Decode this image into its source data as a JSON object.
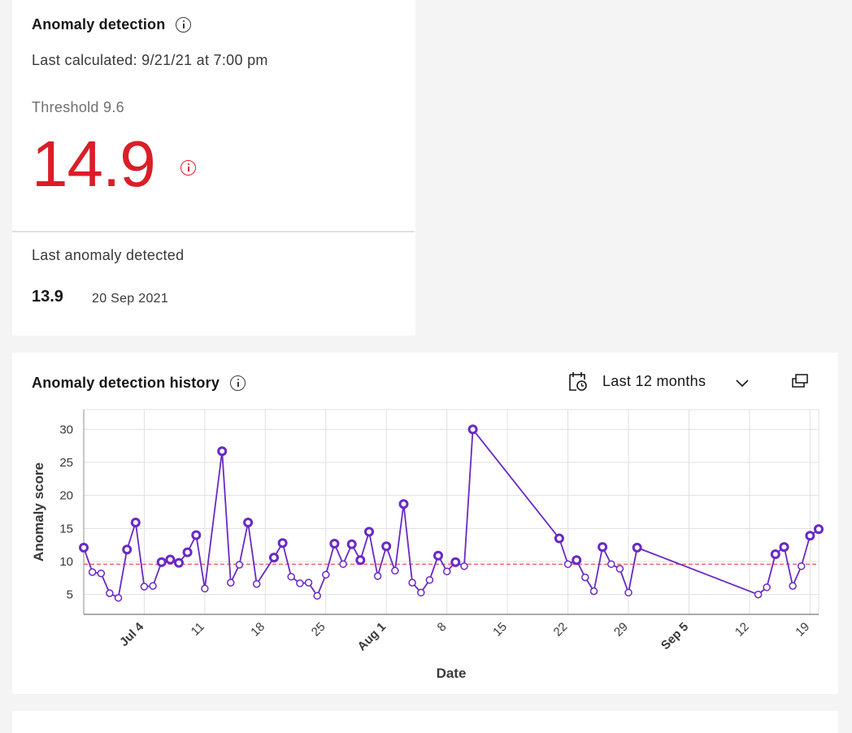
{
  "summary": {
    "title": "Anomaly detection",
    "last_calculated": "Last calculated: 9/21/21 at 7:00 pm",
    "threshold_label": "Threshold 9.6",
    "current_score": "14.9",
    "score_color": "#da1e28",
    "info_icon": "info-icon"
  },
  "last_anomaly": {
    "label": "Last anomaly detected",
    "value": "13.9",
    "date": "20 Sep 2021"
  },
  "history": {
    "title": "Anomaly detection history",
    "range_label": "Last 12 months",
    "calendar_icon": "calendar-clock-icon",
    "chevron_icon": "chevron-down-icon",
    "popout_icon": "popout-icon",
    "series_color": "#6929c4",
    "threshold_color": "#fa4d56"
  },
  "chart_data": {
    "type": "line",
    "title": "Anomaly detection history",
    "xlabel": "Date",
    "ylabel": "Anomaly score",
    "xlim": [
      "2021-06-27",
      "2021-09-20"
    ],
    "ylim": [
      2,
      33
    ],
    "yticks": [
      5,
      10,
      15,
      20,
      25,
      30
    ],
    "xticks": [
      {
        "date": "2021-07-04",
        "label": "Jul 4",
        "bold": true
      },
      {
        "date": "2021-07-11",
        "label": "11",
        "bold": false
      },
      {
        "date": "2021-07-18",
        "label": "18",
        "bold": false
      },
      {
        "date": "2021-07-25",
        "label": "25",
        "bold": false
      },
      {
        "date": "2021-08-01",
        "label": "Aug 1",
        "bold": true
      },
      {
        "date": "2021-08-08",
        "label": "8",
        "bold": false
      },
      {
        "date": "2021-08-15",
        "label": "15",
        "bold": false
      },
      {
        "date": "2021-08-22",
        "label": "22",
        "bold": false
      },
      {
        "date": "2021-08-29",
        "label": "29",
        "bold": false
      },
      {
        "date": "2021-09-05",
        "label": "Sep 5",
        "bold": true
      },
      {
        "date": "2021-09-12",
        "label": "12",
        "bold": false
      },
      {
        "date": "2021-09-19",
        "label": "19",
        "bold": false
      }
    ],
    "grid": true,
    "threshold": 9.6,
    "series": [
      {
        "points": [
          {
            "x": "2021-06-27",
            "y": 12.1,
            "anomaly": true
          },
          {
            "x": "2021-06-28",
            "y": 8.4,
            "anomaly": false
          },
          {
            "x": "2021-06-29",
            "y": 8.2,
            "anomaly": false
          },
          {
            "x": "2021-06-30",
            "y": 5.2,
            "anomaly": false
          },
          {
            "x": "2021-07-01",
            "y": 4.5,
            "anomaly": false
          },
          {
            "x": "2021-07-02",
            "y": 11.8,
            "anomaly": true
          },
          {
            "x": "2021-07-03",
            "y": 15.9,
            "anomaly": true
          },
          {
            "x": "2021-07-04",
            "y": 6.2,
            "anomaly": false
          },
          {
            "x": "2021-07-05",
            "y": 6.3,
            "anomaly": false
          },
          {
            "x": "2021-07-06",
            "y": 9.9,
            "anomaly": true
          },
          {
            "x": "2021-07-07",
            "y": 10.3,
            "anomaly": true
          },
          {
            "x": "2021-07-08",
            "y": 9.8,
            "anomaly": true
          },
          {
            "x": "2021-07-09",
            "y": 11.4,
            "anomaly": true
          },
          {
            "x": "2021-07-10",
            "y": 14.0,
            "anomaly": true
          },
          {
            "x": "2021-07-11",
            "y": 5.9,
            "anomaly": false
          },
          {
            "x": "2021-07-13",
            "y": 26.7,
            "anomaly": true
          },
          {
            "x": "2021-07-14",
            "y": 6.8,
            "anomaly": false
          },
          {
            "x": "2021-07-15",
            "y": 9.5,
            "anomaly": false
          },
          {
            "x": "2021-07-16",
            "y": 15.9,
            "anomaly": true
          },
          {
            "x": "2021-07-17",
            "y": 6.6,
            "anomaly": false
          },
          {
            "x": "2021-07-19",
            "y": 10.6,
            "anomaly": true
          },
          {
            "x": "2021-07-20",
            "y": 12.8,
            "anomaly": true
          },
          {
            "x": "2021-07-21",
            "y": 7.7,
            "anomaly": false
          },
          {
            "x": "2021-07-22",
            "y": 6.7,
            "anomaly": false
          },
          {
            "x": "2021-07-23",
            "y": 6.8,
            "anomaly": false
          },
          {
            "x": "2021-07-24",
            "y": 4.8,
            "anomaly": false
          },
          {
            "x": "2021-07-25",
            "y": 8.0,
            "anomaly": false
          },
          {
            "x": "2021-07-26",
            "y": 12.7,
            "anomaly": true
          },
          {
            "x": "2021-07-27",
            "y": 9.6,
            "anomaly": false
          },
          {
            "x": "2021-07-28",
            "y": 12.6,
            "anomaly": true
          },
          {
            "x": "2021-07-29",
            "y": 10.2,
            "anomaly": true
          },
          {
            "x": "2021-07-30",
            "y": 14.5,
            "anomaly": true
          },
          {
            "x": "2021-07-31",
            "y": 7.8,
            "anomaly": false
          },
          {
            "x": "2021-08-01",
            "y": 12.3,
            "anomaly": true
          },
          {
            "x": "2021-08-02",
            "y": 8.6,
            "anomaly": false
          },
          {
            "x": "2021-08-03",
            "y": 18.7,
            "anomaly": true
          },
          {
            "x": "2021-08-04",
            "y": 6.8,
            "anomaly": false
          },
          {
            "x": "2021-08-05",
            "y": 5.3,
            "anomaly": false
          },
          {
            "x": "2021-08-06",
            "y": 7.2,
            "anomaly": false
          },
          {
            "x": "2021-08-07",
            "y": 10.9,
            "anomaly": true
          },
          {
            "x": "2021-08-08",
            "y": 8.5,
            "anomaly": false
          },
          {
            "x": "2021-08-09",
            "y": 9.9,
            "anomaly": true
          },
          {
            "x": "2021-08-10",
            "y": 9.3,
            "anomaly": false
          },
          {
            "x": "2021-08-11",
            "y": 30.0,
            "anomaly": true
          },
          {
            "x": "2021-08-21",
            "y": 13.5,
            "anomaly": true
          },
          {
            "x": "2021-08-22",
            "y": 9.6,
            "anomaly": false
          },
          {
            "x": "2021-08-23",
            "y": 10.2,
            "anomaly": true
          },
          {
            "x": "2021-08-24",
            "y": 7.6,
            "anomaly": false
          },
          {
            "x": "2021-08-25",
            "y": 5.5,
            "anomaly": false
          },
          {
            "x": "2021-08-26",
            "y": 12.2,
            "anomaly": true
          },
          {
            "x": "2021-08-27",
            "y": 9.6,
            "anomaly": false
          },
          {
            "x": "2021-08-28",
            "y": 8.9,
            "anomaly": false
          },
          {
            "x": "2021-08-29",
            "y": 5.3,
            "anomaly": false
          },
          {
            "x": "2021-08-30",
            "y": 12.1,
            "anomaly": true
          },
          {
            "x": "2021-09-13",
            "y": 5.0,
            "anomaly": false
          },
          {
            "x": "2021-09-14",
            "y": 6.1,
            "anomaly": false
          },
          {
            "x": "2021-09-15",
            "y": 11.1,
            "anomaly": true
          },
          {
            "x": "2021-09-16",
            "y": 12.2,
            "anomaly": true
          },
          {
            "x": "2021-09-17",
            "y": 6.3,
            "anomaly": false
          },
          {
            "x": "2021-09-18",
            "y": 9.3,
            "anomaly": false
          },
          {
            "x": "2021-09-19",
            "y": 13.9,
            "anomaly": true
          },
          {
            "x": "2021-09-20",
            "y": 14.9,
            "anomaly": true
          }
        ]
      }
    ]
  }
}
